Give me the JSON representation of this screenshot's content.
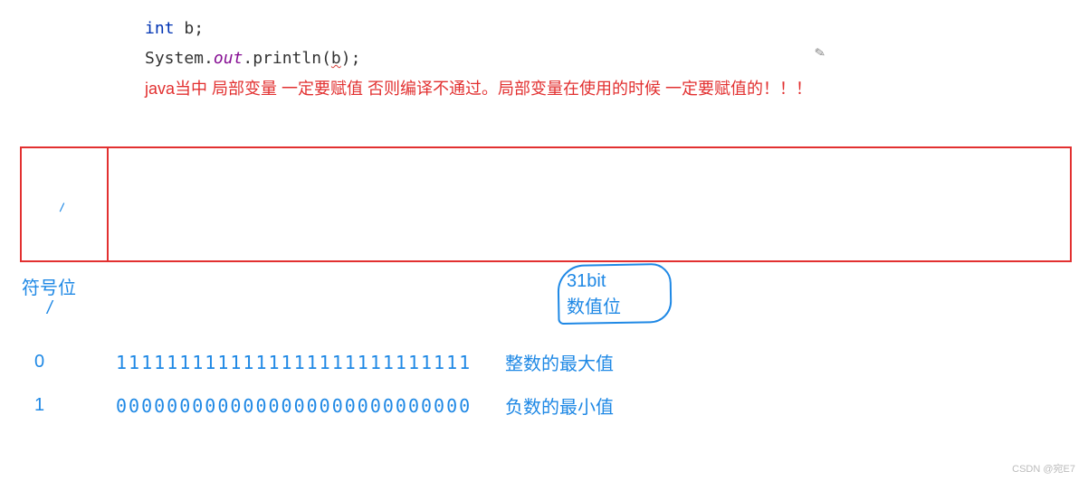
{
  "code": {
    "line1": {
      "keyword": "int",
      "var": " b;"
    },
    "line2": {
      "part1": "System.",
      "out": "out",
      "part2": ".println(",
      "arg": "b",
      "part3": ");"
    }
  },
  "comment": "java当中 局部变量 一定要赋值 否则编译不通过。局部变量在使用的时候 一定要赋值的！！！",
  "labels": {
    "signBit": "符号位",
    "bit31_line1": "31bit",
    "bit31_line2": "数值位"
  },
  "rows": [
    {
      "sign": "0",
      "bits": "1111111111111111111111111111",
      "desc": "整数的最大值"
    },
    {
      "sign": "1",
      "bits": "0000000000000000000000000000",
      "desc": "负数的最小值"
    }
  ],
  "glyphs": {
    "tick": "⸝",
    "arrow": "/"
  },
  "watermark": "CSDN @宛E7"
}
